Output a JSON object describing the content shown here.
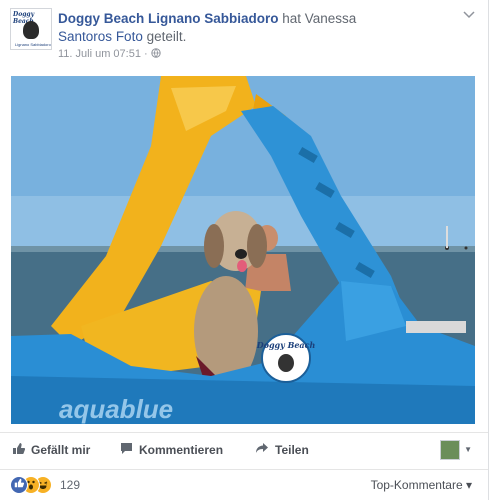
{
  "post": {
    "page_name": "Doggy Beach Lignano Sabbiadoro",
    "text_after_name": " hat Vanessa",
    "shared_person": "Santoros",
    "shared_photo_link": "Foto",
    "shared_suffix": " geteilt.",
    "timestamp": "11. Juli um 07:51",
    "separator": " · ",
    "privacy_icon": "globe-icon",
    "avatar_text": "Doggy Beach",
    "avatar_sub": "Lignano Sabbiadoro"
  },
  "photo": {
    "boat_brand": "aquablue",
    "sticker_text": "Doggy Beach",
    "colors": {
      "sky": "#6fa9d8",
      "sea": "#3e7596",
      "boat": "#2e8fcf",
      "slide": "#f4b21a"
    }
  },
  "actions": {
    "like_label": "Gefällt mir",
    "comment_label": "Kommentieren",
    "share_label": "Teilen"
  },
  "reactions": {
    "types": [
      "like",
      "wow",
      "haha"
    ],
    "count": "129",
    "sort_label": "Top-Kommentare",
    "sort_caret": "▾"
  },
  "icons": {
    "like": "👍",
    "comment": "▬",
    "share": "➦",
    "chevron": "∨",
    "globe": "🌐"
  },
  "theme": {
    "link_color": "#365899",
    "muted": "#90949c",
    "like_blue": "#4267b2"
  }
}
